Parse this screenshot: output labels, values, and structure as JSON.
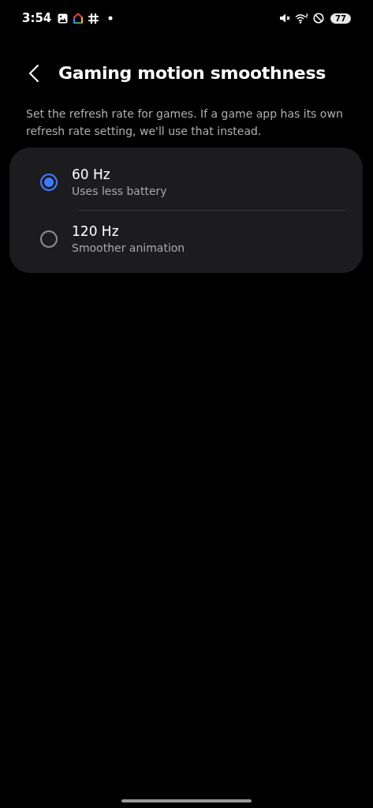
{
  "status_bar": {
    "time": "3:54",
    "battery": "77"
  },
  "header": {
    "title": "Gaming motion smoothness"
  },
  "description": "Set the refresh rate for games. If a game app has its own refresh rate setting, we'll use that instead.",
  "options": [
    {
      "label": "60 Hz",
      "sublabel": "Uses less battery",
      "selected": true
    },
    {
      "label": "120 Hz",
      "sublabel": "Smoother animation",
      "selected": false
    }
  ]
}
